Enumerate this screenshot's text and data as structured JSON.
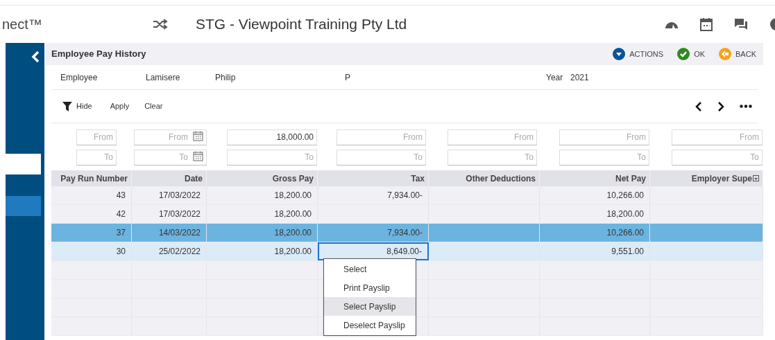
{
  "app": {
    "brand": "nect™",
    "company": "STG - Viewpoint Training Pty Ltd"
  },
  "page": {
    "title": "Employee Pay History",
    "actions": [
      {
        "kind": "actions",
        "label": "ACTIONS"
      },
      {
        "kind": "ok",
        "label": "OK"
      },
      {
        "kind": "back",
        "label": "BACK"
      }
    ]
  },
  "employee": {
    "label": "Employee",
    "surname": "Lamisere",
    "first_name": "Philip",
    "initial": "P",
    "year_label": "Year",
    "year": "2021"
  },
  "toolbar": {
    "hide": "Hide",
    "apply": "Apply",
    "clear": "Clear"
  },
  "filters": [
    {
      "kind": "text",
      "from": {
        "placeholder": "From"
      },
      "to": {
        "placeholder": "To"
      }
    },
    {
      "kind": "date",
      "from": {
        "placeholder": "From"
      },
      "to": {
        "placeholder": "To"
      }
    },
    {
      "kind": "text",
      "from": {
        "value": "18,000.00"
      },
      "to": {
        "placeholder": "To"
      }
    },
    {
      "kind": "text",
      "from": {
        "placeholder": "From"
      },
      "to": {
        "placeholder": "To"
      }
    },
    {
      "kind": "text",
      "from": {
        "placeholder": "From"
      },
      "to": {
        "placeholder": "To"
      }
    },
    {
      "kind": "text",
      "from": {
        "placeholder": "From"
      },
      "to": {
        "placeholder": "To"
      }
    },
    {
      "kind": "text",
      "from": {
        "placeholder": "From"
      },
      "to": {
        "placeholder": "To"
      }
    }
  ],
  "table": {
    "columns": [
      "Pay Run Number",
      "Date",
      "Gross Pay",
      "Tax",
      "Other Deductions",
      "Net Pay",
      "Employer Supe"
    ],
    "rows": [
      {
        "selected": false,
        "highlighted": false,
        "cells": [
          {
            "text": "43",
            "focused": false
          },
          {
            "text": "17/03/2022",
            "focused": false
          },
          {
            "text": "18,200.00",
            "focused": false
          },
          {
            "text": "7,934.00-",
            "focused": false
          },
          {
            "focused": false
          },
          {
            "text": "10,266.00",
            "focused": false
          },
          {
            "focused": false
          }
        ]
      },
      {
        "selected": false,
        "highlighted": false,
        "cells": [
          {
            "text": "42",
            "focused": false
          },
          {
            "text": "17/03/2022",
            "focused": false
          },
          {
            "text": "18,200.00",
            "focused": false
          },
          {
            "focused": false
          },
          {
            "focused": false
          },
          {
            "text": "18,200.00",
            "focused": false
          },
          {
            "focused": false
          }
        ]
      },
      {
        "selected": true,
        "highlighted": false,
        "cells": [
          {
            "text": "37",
            "focused": false
          },
          {
            "text": "14/03/2022",
            "focused": false
          },
          {
            "text": "18,200.00",
            "focused": false
          },
          {
            "text": "7,934.00-",
            "focused": false
          },
          {
            "focused": false
          },
          {
            "text": "10,266.00",
            "focused": false
          },
          {
            "focused": false
          }
        ]
      },
      {
        "selected": false,
        "highlighted": true,
        "cells": [
          {
            "text": "30",
            "focused": false
          },
          {
            "text": "25/02/2022",
            "focused": false
          },
          {
            "text": "18,200.00",
            "focused": false
          },
          {
            "text": "8,649.00-",
            "focused": true
          },
          {
            "focused": false
          },
          {
            "text": "9,551.00",
            "focused": false
          },
          {
            "focused": false
          }
        ]
      }
    ]
  },
  "context_menu": [
    {
      "label": "Select",
      "selected": false
    },
    {
      "label": "Print Payslip",
      "selected": false
    },
    {
      "label": "Select Payslip",
      "selected": true
    },
    {
      "label": "Deselect Payslip",
      "selected": false
    }
  ]
}
